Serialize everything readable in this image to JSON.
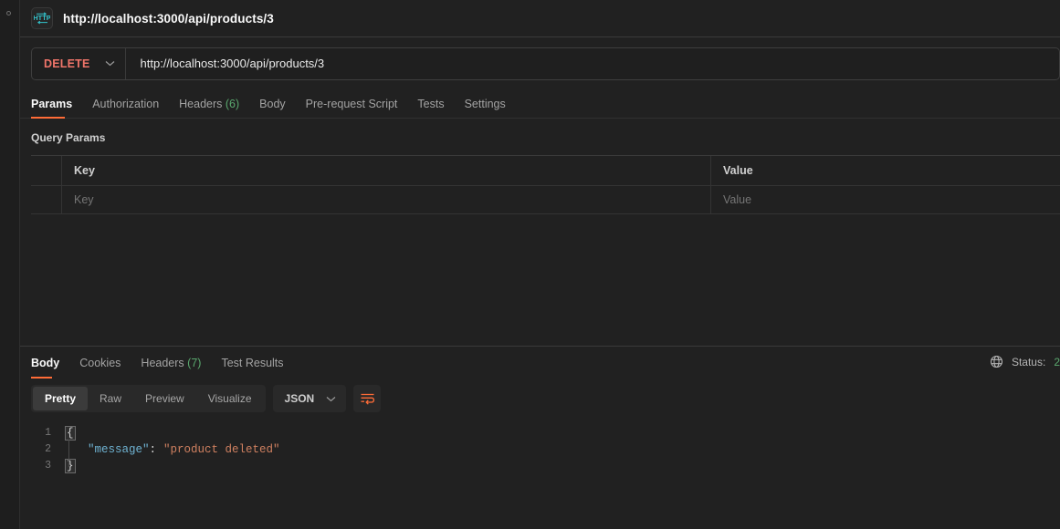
{
  "left_rail": {
    "dot_icon": "circle-icon",
    "scrollbar": "vertical-scrollbar"
  },
  "request": {
    "protocol_icon": "http-protocol-icon",
    "title": "http://localhost:3000/api/products/3",
    "method": "DELETE",
    "method_chevron_icon": "chevron-down-icon",
    "url": "http://localhost:3000/api/products/3",
    "tabs": [
      {
        "label": "Params",
        "count": "",
        "active": true
      },
      {
        "label": "Authorization",
        "count": "",
        "active": false
      },
      {
        "label": "Headers",
        "count": "(6)",
        "active": false
      },
      {
        "label": "Body",
        "count": "",
        "active": false
      },
      {
        "label": "Pre-request Script",
        "count": "",
        "active": false
      },
      {
        "label": "Tests",
        "count": "",
        "active": false
      },
      {
        "label": "Settings",
        "count": "",
        "active": false
      }
    ]
  },
  "query_params": {
    "section_title": "Query Params",
    "columns": [
      "Key",
      "Value"
    ],
    "placeholder_row": {
      "key": "Key",
      "value": "Value"
    }
  },
  "response": {
    "tabs": [
      {
        "label": "Body",
        "count": "",
        "active": true
      },
      {
        "label": "Cookies",
        "count": "",
        "active": false
      },
      {
        "label": "Headers",
        "count": "(7)",
        "active": false
      },
      {
        "label": "Test Results",
        "count": "",
        "active": false
      }
    ],
    "globe_icon": "globe-icon",
    "status_label": "Status:",
    "status_code": "2",
    "view_modes": [
      {
        "label": "Pretty",
        "active": true
      },
      {
        "label": "Raw",
        "active": false
      },
      {
        "label": "Preview",
        "active": false
      },
      {
        "label": "Visualize",
        "active": false
      }
    ],
    "format": "JSON",
    "format_chevron_icon": "chevron-down-icon",
    "wrap_icon": "wrap-text-icon",
    "body_lines": [
      {
        "n": "1",
        "open_brace": "{",
        "key": "",
        "colon": "",
        "value": "",
        "close_brace": ""
      },
      {
        "n": "2",
        "open_brace": "",
        "key": "\"message\"",
        "colon": ":",
        "value": "\"product deleted\"",
        "close_brace": ""
      },
      {
        "n": "3",
        "open_brace": "",
        "key": "",
        "colon": "",
        "value": "",
        "close_brace": "}"
      }
    ]
  },
  "colors": {
    "background": "#212121",
    "accent": "#ff6c37",
    "method_delete": "#f0756a",
    "count_green": "#5aa86e",
    "json_key": "#6fb3d2",
    "json_string": "#cf8060",
    "protocol_icon": "#33c3cc"
  }
}
